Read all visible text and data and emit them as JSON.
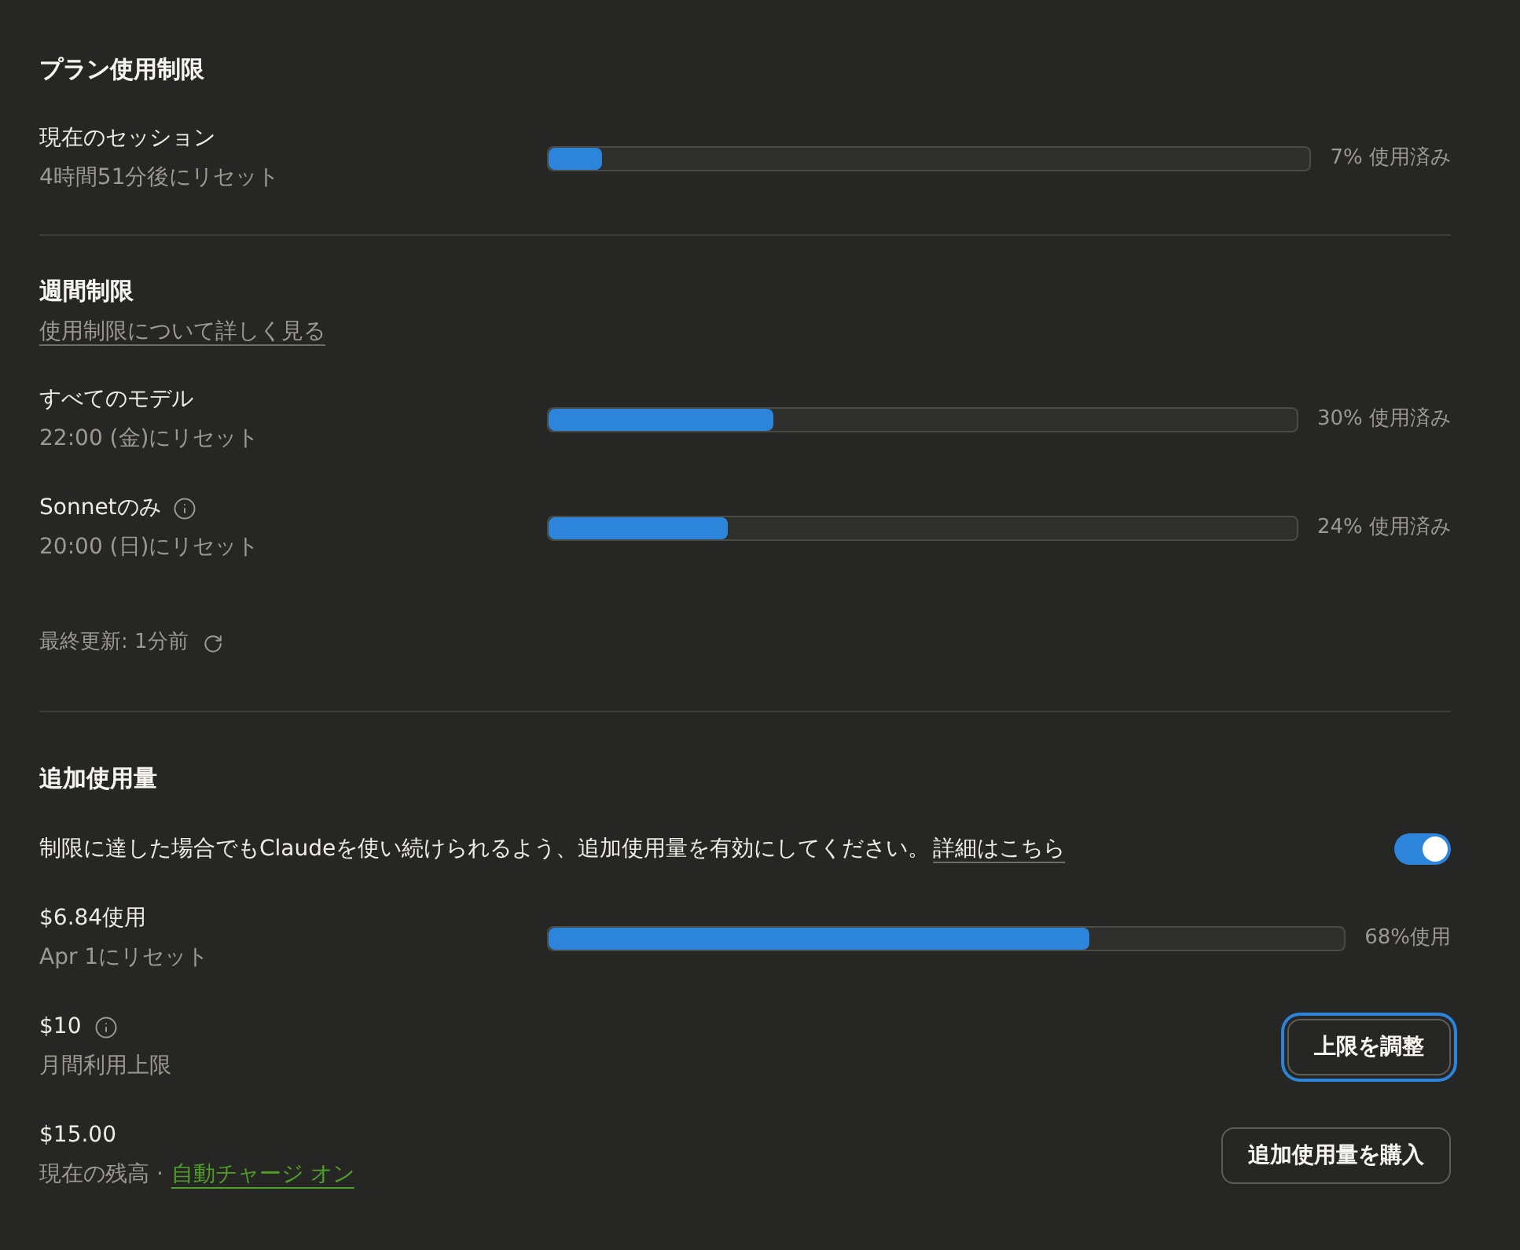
{
  "plan_limits": {
    "title": "プラン使用制限",
    "rows": [
      {
        "name": "現在のセッション",
        "reset": "4時間51分後にリセット",
        "level": 0.07,
        "reading": "7% 使用済み"
      }
    ]
  },
  "weekly_limits": {
    "title": "週間制限",
    "link": "使用制限について詳しく見る",
    "rows": [
      {
        "name": "すべてのモデル",
        "info": false,
        "reset": "22:00 (金)にリセット",
        "level": 0.3,
        "reading": "30% 使用済み"
      },
      {
        "name": "Sonnetのみ",
        "info": true,
        "reset": "20:00 (日)にリセット",
        "level": 0.24,
        "reading": "24% 使用済み"
      }
    ],
    "last_updated": "最終更新: 1分前"
  },
  "extra_usage": {
    "title": "追加使用量",
    "description": "制限に達した場合でもClaudeを使い続けられるよう、追加使用量を有効にしてください。",
    "link": "詳細はこちら",
    "enabled": true,
    "usage": {
      "name": "$6.84使用",
      "reset": "Apr 1にリセット",
      "level": 0.68,
      "reading": "68%使用"
    },
    "limit": {
      "amount": "$10",
      "label": "月間利用上限",
      "button": {
        "label": "上限を調整",
        "focused": true
      }
    },
    "balance": {
      "amount": "$15.00",
      "label": "現在の残高 ·",
      "link": "自動チャージ オン",
      "button": {
        "label": "追加使用量を購入",
        "focused": false
      }
    }
  }
}
